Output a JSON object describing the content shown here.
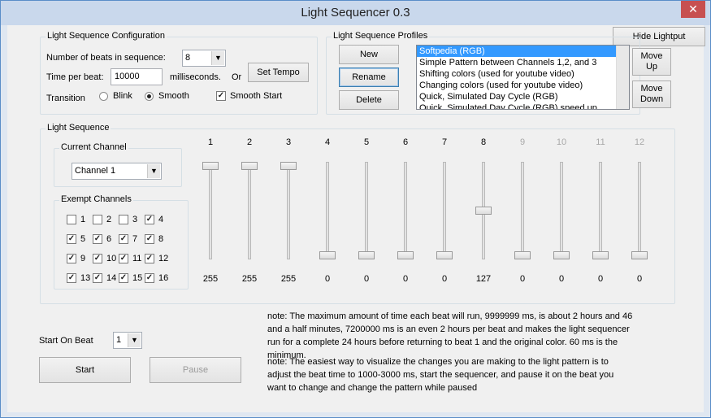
{
  "window": {
    "title": "Light Sequencer 0.3",
    "close": "✕"
  },
  "hide_lightput": "Hide Lightput",
  "config": {
    "title": "Light Sequence Configuration",
    "beats_label": "Number of beats in sequence:",
    "beats_value": "8",
    "time_label": "Time per beat:",
    "time_value": "10000",
    "ms_label": "milliseconds.",
    "or_label": "Or",
    "set_tempo": "Set Tempo",
    "transition_label": "Transition",
    "blink": "Blink",
    "smooth": "Smooth",
    "smooth_start": "Smooth Start",
    "transition_selected": "Smooth",
    "smooth_start_checked": true
  },
  "profiles": {
    "title": "Light Sequence Profiles",
    "new": "New",
    "rename": "Rename",
    "delete": "Delete",
    "move_up": [
      "Move",
      "Up"
    ],
    "move_down": [
      "Move",
      "Down"
    ],
    "items": [
      "Softpedia (RGB)",
      "Simple Pattern between Channels 1,2, and 3",
      "Shifting colors (used for youtube video)",
      "Changing colors (used for youtube video)",
      "Quick, Simulated Day Cycle (RGB)",
      "Quick, Simulated Day Cycle (RGB) speed up"
    ],
    "selected_index": 0
  },
  "sequence": {
    "title": "Light Sequence",
    "current_channel_title": "Current Channel",
    "current_channel": "Channel 1",
    "exempt_title": "Exempt Channels",
    "exempt": [
      {
        "n": "1",
        "on": false
      },
      {
        "n": "2",
        "on": false
      },
      {
        "n": "3",
        "on": false
      },
      {
        "n": "4",
        "on": true
      },
      {
        "n": "5",
        "on": true
      },
      {
        "n": "6",
        "on": true
      },
      {
        "n": "7",
        "on": true
      },
      {
        "n": "8",
        "on": true
      },
      {
        "n": "9",
        "on": true
      },
      {
        "n": "10",
        "on": true
      },
      {
        "n": "11",
        "on": true
      },
      {
        "n": "12",
        "on": true
      },
      {
        "n": "13",
        "on": true
      },
      {
        "n": "14",
        "on": true
      },
      {
        "n": "15",
        "on": true
      },
      {
        "n": "16",
        "on": true
      }
    ],
    "channels": [
      {
        "label": "1",
        "value": 255,
        "enabled": true
      },
      {
        "label": "2",
        "value": 255,
        "enabled": true
      },
      {
        "label": "3",
        "value": 255,
        "enabled": true
      },
      {
        "label": "4",
        "value": 0,
        "enabled": true
      },
      {
        "label": "5",
        "value": 0,
        "enabled": true
      },
      {
        "label": "6",
        "value": 0,
        "enabled": true
      },
      {
        "label": "7",
        "value": 0,
        "enabled": true
      },
      {
        "label": "8",
        "value": 127,
        "enabled": true
      },
      {
        "label": "9",
        "value": 0,
        "enabled": false
      },
      {
        "label": "10",
        "value": 0,
        "enabled": false
      },
      {
        "label": "11",
        "value": 0,
        "enabled": false
      },
      {
        "label": "12",
        "value": 0,
        "enabled": false
      }
    ]
  },
  "start_on_beat_label": "Start On Beat",
  "start_on_beat_value": "1",
  "start": "Start",
  "pause": "Pause",
  "note1": "note: The maximum amount of time each beat will run, 9999999 ms, is about 2 hours and 46 and a half minutes, 7200000 ms is an even 2 hours per beat and makes the light sequencer run for a complete 24 hours before returning to beat 1 and the original color.  60 ms is the minimum.",
  "note2": "note: The easiest way to visualize the changes you are making to the light pattern is to adjust the beat time to 1000-3000 ms, start the sequencer, and pause it on the beat you want to change and change the pattern while paused"
}
